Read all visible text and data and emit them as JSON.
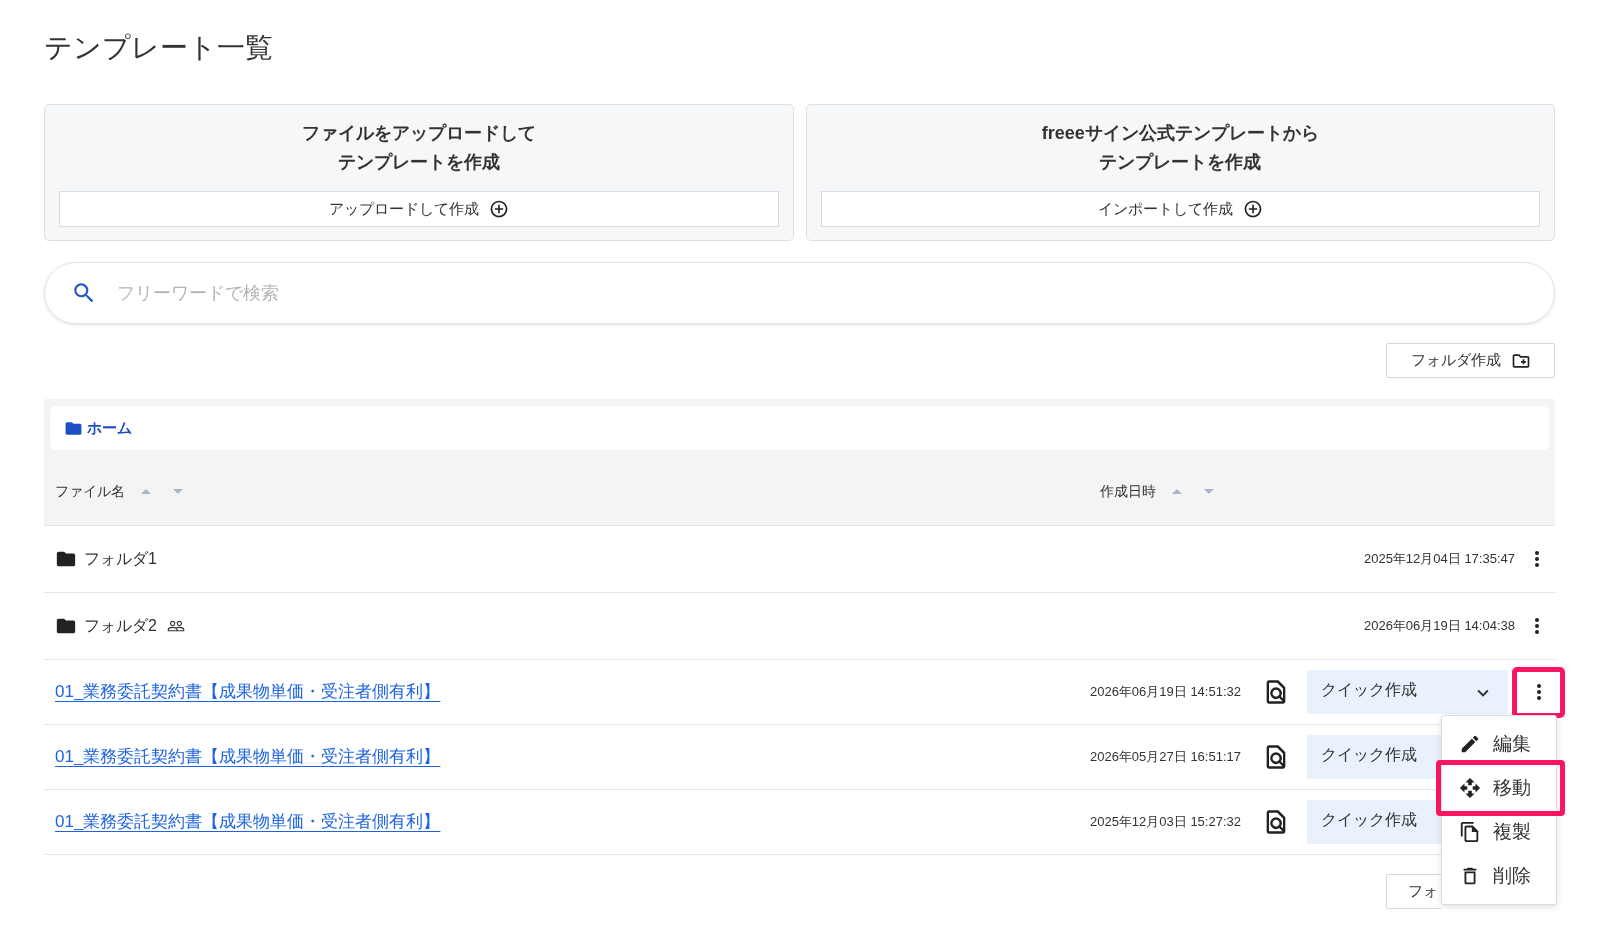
{
  "page": {
    "title": "テンプレート一覧"
  },
  "create_cards": [
    {
      "title_lines": [
        "ファイルをアップロードして",
        "テンプレートを作成"
      ],
      "button": "アップロードして作成"
    },
    {
      "title_lines": [
        "freeeサイン公式テンプレートから",
        "テンプレートを作成"
      ],
      "button": "インポートして作成"
    }
  ],
  "search": {
    "placeholder": "フリーワードで検索"
  },
  "folder_create_button": "フォルダ作成",
  "breadcrumb": {
    "label": "ホーム"
  },
  "table": {
    "columns": [
      {
        "label": "ファイル名"
      },
      {
        "label": "作成日時"
      }
    ],
    "rows": [
      {
        "kind": "folder",
        "name": "フォルダ1",
        "shared": false,
        "created": "2025年12月04日 17:35:47",
        "highlighted": false
      },
      {
        "kind": "folder",
        "name": "フォルダ2",
        "shared": true,
        "created": "2026年06月19日 14:04:38",
        "highlighted": false
      },
      {
        "kind": "file",
        "name": "01_業務委託契約書【成果物単価・受注者側有利】",
        "created": "2026年06月19日 14:51:32",
        "quick_create": "クイック作成",
        "highlighted": true,
        "menu": {
          "items": [
            {
              "kind": "edit",
              "label": "編集",
              "highlighted": false
            },
            {
              "kind": "move",
              "label": "移動",
              "highlighted": true
            },
            {
              "kind": "copy",
              "label": "複製",
              "highlighted": false
            },
            {
              "kind": "delete",
              "label": "削除",
              "highlighted": false
            }
          ]
        }
      },
      {
        "kind": "file",
        "name": "01_業務委託契約書【成果物単価・受注者側有利】",
        "created": "2026年05月27日 16:51:17",
        "quick_create": "クイック作成"
      },
      {
        "kind": "file",
        "name": "01_業務委託契約書【成果物単価・受注者側有利】",
        "created": "2025年12月03日 15:27:32",
        "quick_create": "クイック作成"
      }
    ]
  },
  "bottom_button": {
    "label": "フォ"
  }
}
